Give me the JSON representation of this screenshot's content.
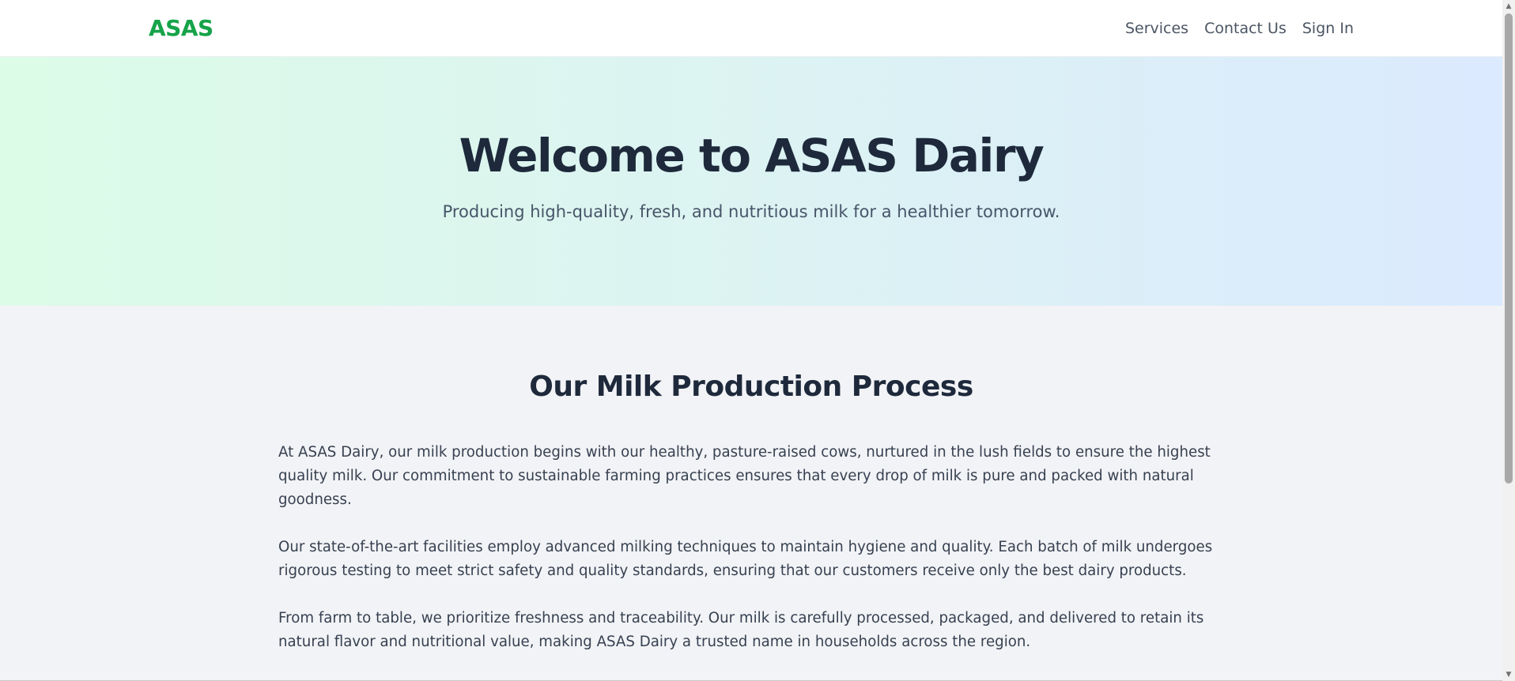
{
  "nav": {
    "logo": "ASAS",
    "links": [
      "Services",
      "Contact Us",
      "Sign In"
    ]
  },
  "hero": {
    "title": "Welcome to ASAS Dairy",
    "subtitle": "Producing high-quality, fresh, and nutritious milk for a healthier tomorrow."
  },
  "process": {
    "heading": "Our Milk Production Process",
    "paragraphs": [
      "At ASAS Dairy, our milk production begins with our healthy, pasture-raised cows, nurtured in the lush fields to ensure the highest quality milk. Our commitment to sustainable farming practices ensures that every drop of milk is pure and packed with natural goodness.",
      "Our state-of-the-art facilities employ advanced milking techniques to maintain hygiene and quality. Each batch of milk undergoes rigorous testing to meet strict safety and quality standards, ensuring that our customers receive only the best dairy products.",
      "From farm to table, we prioritize freshness and traceability. Our milk is carefully processed, packaged, and delivered to retain its natural flavor and nutritional value, making ASAS Dairy a trusted name in households across the region."
    ]
  },
  "colors": {
    "brand": "#16a34a",
    "hero_gradient_start": "#dcfce7",
    "hero_gradient_end": "#dbeafe",
    "heading": "#1e293b",
    "body_background": "#f2f3f6"
  },
  "scrollbar": {
    "icons": [
      "scroll-up-arrow-icon",
      "scroll-down-arrow-icon"
    ]
  }
}
